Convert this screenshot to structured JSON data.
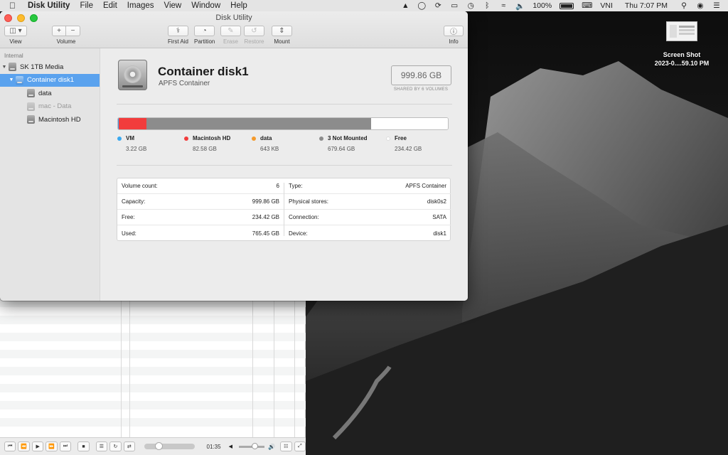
{
  "menubar": {
    "app_name": "Disk Utility",
    "items": [
      "File",
      "Edit",
      "Images",
      "View",
      "Window",
      "Help"
    ],
    "battery_percent": "100%",
    "input_source": "VNI",
    "clock": "Thu 7:07 PM"
  },
  "desktop": {
    "file_name_line1": "Screen Shot",
    "file_name_line2": "2023-0....59.10 PM"
  },
  "window": {
    "title": "Disk Utility",
    "toolbar": {
      "view_label": "View",
      "volume_label": "Volume",
      "first_aid_label": "First Aid",
      "partition_label": "Partition",
      "erase_label": "Erase",
      "restore_label": "Restore",
      "mount_label": "Mount",
      "info_label": "Info"
    },
    "sidebar": {
      "header": "Internal",
      "items": [
        {
          "label": "SK 1TB Media"
        },
        {
          "label": "Container disk1"
        },
        {
          "label": "data"
        },
        {
          "label": "mac - Data"
        },
        {
          "label": "Macintosh HD"
        }
      ]
    },
    "volume": {
      "name": "Container disk1",
      "subtitle": "APFS Container",
      "size": "999.86 GB",
      "shared_note": "SHARED BY 6 VOLUMES"
    },
    "usage": {
      "segments": [
        {
          "name": "VM",
          "value": "3.22 GB",
          "color": "#3aa9f0",
          "fraction": 0.003
        },
        {
          "name": "Macintosh HD",
          "value": "82.58 GB",
          "color": "#f23c3c",
          "fraction": 0.083
        },
        {
          "name": "data",
          "value": "643 KB",
          "color": "#f59a2c",
          "fraction": 0.0
        },
        {
          "name": "3 Not Mounted",
          "value": "679.64 GB",
          "color": "#8c8c8c",
          "fraction": 0.68
        },
        {
          "name": "Free",
          "value": "234.42 GB",
          "color": "#ffffff",
          "fraction": 0.234
        }
      ]
    },
    "info_left": [
      {
        "key": "Volume count:",
        "value": "6"
      },
      {
        "key": "Capacity:",
        "value": "999.86 GB"
      },
      {
        "key": "Free:",
        "value": "234.42 GB"
      },
      {
        "key": "Used:",
        "value": "765.45 GB"
      }
    ],
    "info_right": [
      {
        "key": "Type:",
        "value": "APFS Container"
      },
      {
        "key": "Physical stores:",
        "value": "disk0s2"
      },
      {
        "key": "Connection:",
        "value": "SATA"
      },
      {
        "key": "Device:",
        "value": "disk1"
      }
    ]
  },
  "player": {
    "time": "01:35",
    "progress_fraction": 0.25,
    "volume_fraction": 0.55
  }
}
